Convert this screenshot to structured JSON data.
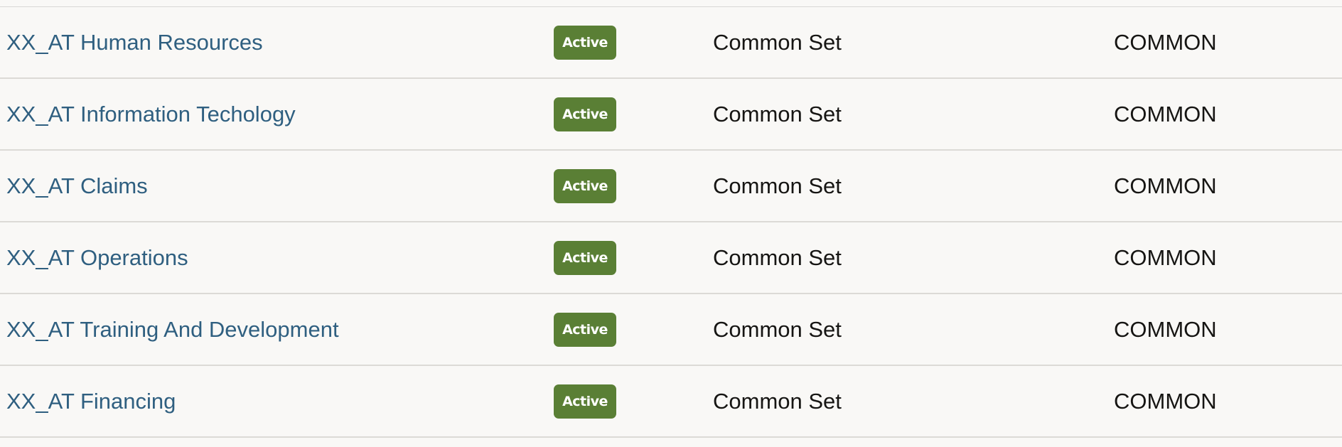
{
  "rows": [
    {
      "name": "XX_AT Human Resources",
      "status": "Active",
      "set": "Common Set",
      "code": "COMMON"
    },
    {
      "name": "XX_AT Information Techology",
      "status": "Active",
      "set": "Common Set",
      "code": "COMMON"
    },
    {
      "name": "XX_AT Claims",
      "status": "Active",
      "set": "Common Set",
      "code": "COMMON"
    },
    {
      "name": "XX_AT Operations",
      "status": "Active",
      "set": "Common Set",
      "code": "COMMON"
    },
    {
      "name": "XX_AT Training And Development",
      "status": "Active",
      "set": "Common Set",
      "code": "COMMON"
    },
    {
      "name": "XX_AT Financing",
      "status": "Active",
      "set": "Common Set",
      "code": "COMMON"
    }
  ],
  "colors": {
    "link": "#2f5f80",
    "badge": "#5a7f35",
    "background": "#f9f8f6",
    "divider": "#dcdad6"
  }
}
